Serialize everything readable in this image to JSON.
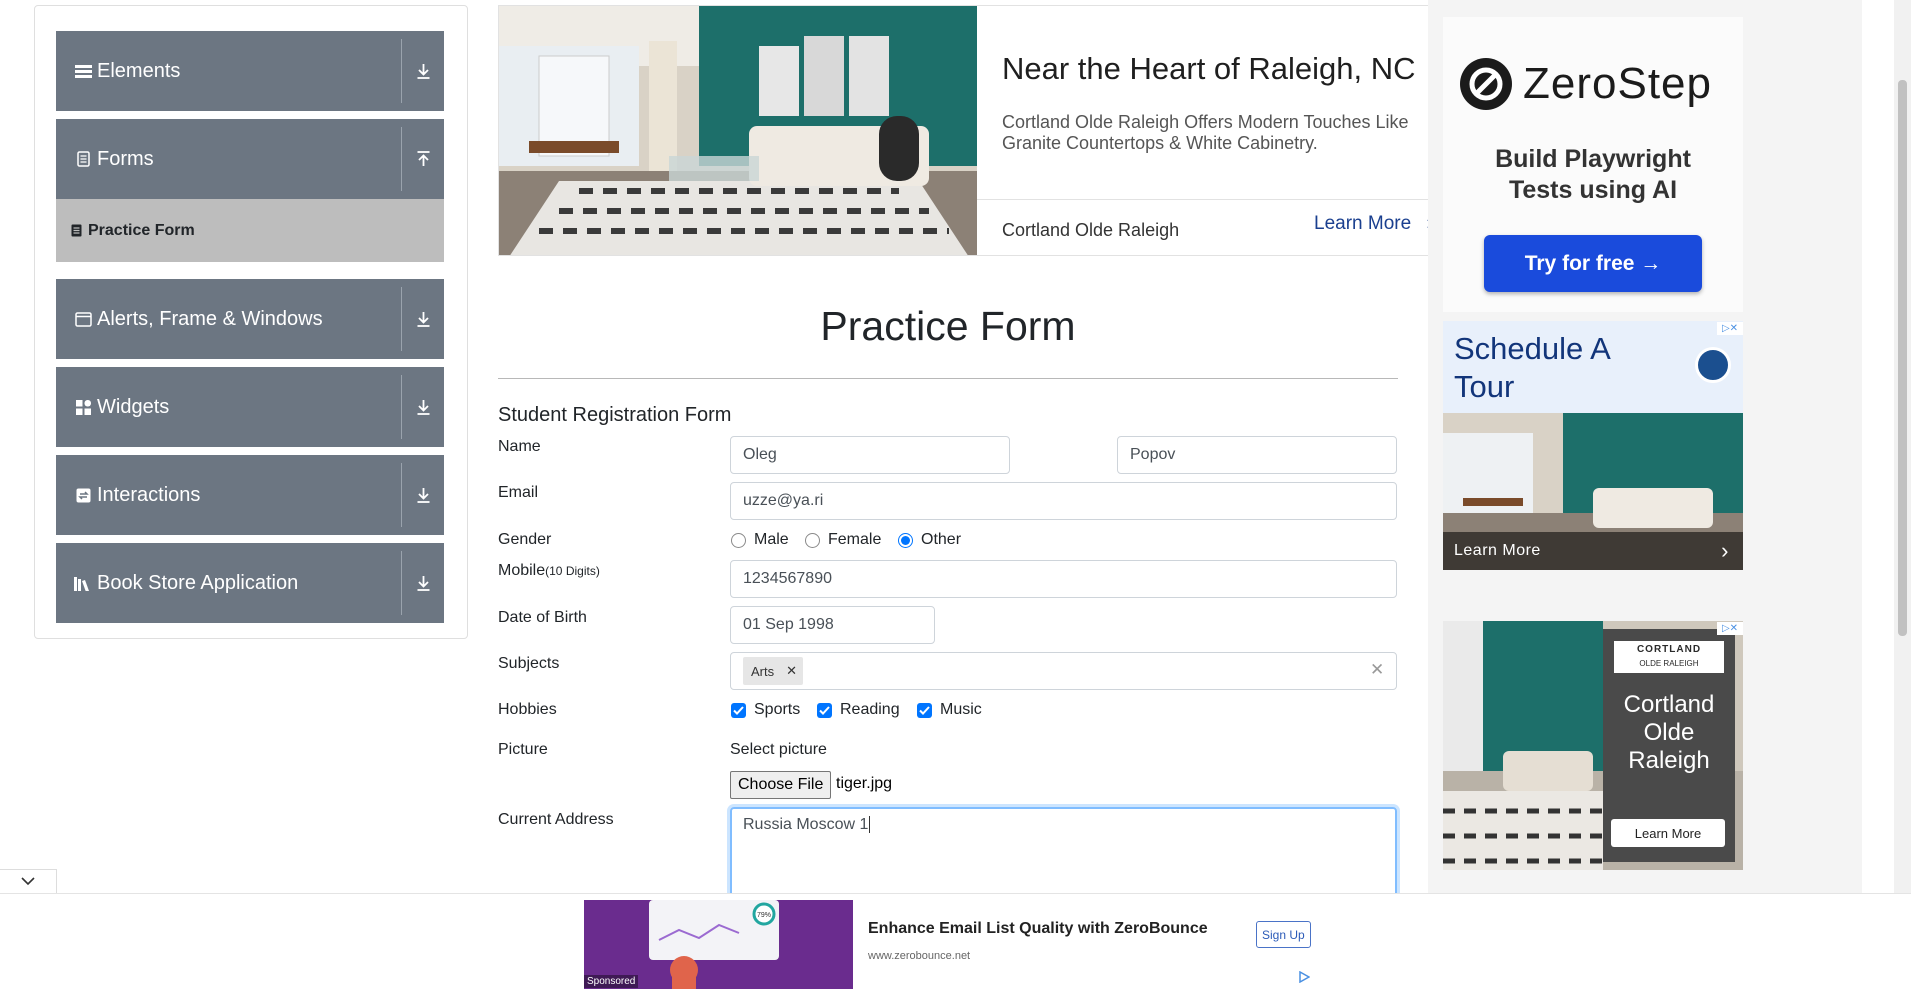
{
  "sidebar": {
    "groups": [
      {
        "label": "Elements",
        "icon": "hamburger-icon",
        "arrow": "down"
      },
      {
        "label": "Forms",
        "icon": "document-icon",
        "arrow": "up"
      },
      {
        "label": "Alerts, Frame & Windows",
        "icon": "window-icon",
        "arrow": "down"
      },
      {
        "label": "Widgets",
        "icon": "grid-icon",
        "arrow": "down"
      },
      {
        "label": "Interactions",
        "icon": "interactions-icon",
        "arrow": "down"
      },
      {
        "label": "Book Store Application",
        "icon": "books-icon",
        "arrow": "down"
      }
    ],
    "active_item": "Practice Form"
  },
  "top_ad": {
    "headline": "Near the Heart of Raleigh, NC",
    "description": "Cortland Olde Raleigh Offers Modern Touches Like Granite Countertops & White Cabinetry.",
    "brand": "Cortland Olde Raleigh",
    "cta": "Learn More"
  },
  "form": {
    "title": "Practice Form",
    "subtitle": "Student Registration Form",
    "labels": {
      "name": "Name",
      "email": "Email",
      "gender": "Gender",
      "mobile": "Mobile",
      "mobile_hint": "(10 Digits)",
      "dob": "Date of Birth",
      "subjects": "Subjects",
      "hobbies": "Hobbies",
      "picture": "Picture",
      "address": "Current Address"
    },
    "first_name": "Oleg",
    "last_name": "Popov",
    "email": "uzze@ya.ri",
    "gender_options": [
      {
        "label": "Male",
        "selected": false
      },
      {
        "label": "Female",
        "selected": false
      },
      {
        "label": "Other",
        "selected": true
      }
    ],
    "mobile": "1234567890",
    "dob": "01 Sep 1998",
    "subjects": [
      "Arts"
    ],
    "hobbies": [
      {
        "label": "Sports",
        "checked": true
      },
      {
        "label": "Reading",
        "checked": true
      },
      {
        "label": "Music",
        "checked": true
      }
    ],
    "select_picture": "Select picture",
    "choose_file": "Choose File",
    "file_name": "tiger.jpg",
    "current_address": "Russia Moscow 1"
  },
  "right_ads": {
    "zerostep": {
      "logo": "ZeroStep",
      "tagline_line1": "Build Playwright",
      "tagline_line2": "Tests using AI",
      "button": "Try for free →"
    },
    "tour": {
      "headline": "Schedule A Tour",
      "cta": "Learn More"
    },
    "cortland": {
      "logo_line1": "CORTLAND",
      "logo_line2": "OLDE RALEIGH",
      "name": "Cortland Olde Raleigh",
      "cta": "Learn More"
    }
  },
  "bottom_ad": {
    "title": "Enhance Email List Quality with ZeroBounce",
    "url": "www.zerobounce.net",
    "cta": "Sign Up",
    "sponsored": "Sponsored",
    "thumb_stat": "79%"
  },
  "colors": {
    "sidebar_group": "#6c7682",
    "sidebar_active": "#bdbdbd",
    "accent_blue": "#0075ff",
    "zerostep_button": "#1a4bdc"
  }
}
